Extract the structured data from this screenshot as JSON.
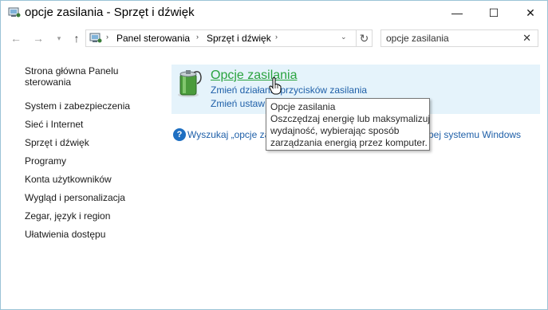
{
  "window": {
    "title": "opcje zasilania - Sprzęt i dźwięk",
    "controls": {
      "minimize": "—",
      "maximize": "☐",
      "close": "✕"
    }
  },
  "nav": {
    "back": "←",
    "forward": "→",
    "recent": "▾",
    "up": "↑",
    "breadcrumbs": [
      "Panel sterowania",
      "Sprzęt i dźwięk"
    ],
    "separator": "›",
    "dropdown": "⌄",
    "refresh": "↻"
  },
  "search": {
    "value": "opcje zasilania",
    "clear": "✕"
  },
  "sidebar": {
    "items": [
      {
        "label": "Strona główna Panelu"
      },
      {
        "label": "sterowania"
      },
      {
        "label": "System i zabezpieczenia"
      },
      {
        "label": "Sieć i Internet"
      },
      {
        "label": "Sprzęt i dźwięk"
      },
      {
        "label": "Programy"
      },
      {
        "label": "Konta użytkowników"
      },
      {
        "label": "Wygląd i personalizacja"
      },
      {
        "label": "Zegar, język i region"
      },
      {
        "label": "Ułatwienia dostępu"
      }
    ]
  },
  "result": {
    "title": "Opcje zasilania",
    "link1": "Zmień działanie przycisków zasilania",
    "link2": "Zmień ustaw"
  },
  "help": {
    "text": "Wyszukaj „opcje zasi",
    "text_tail": "pej systemu Windows",
    "icon": "?"
  },
  "tooltip": {
    "lines": [
      "Opcje zasilania",
      "Oszczędzaj energię lub maksymalizuj",
      "wydajność, wybierając sposób",
      "zarządzania energią przez komputer."
    ]
  },
  "colors": {
    "accent_link": "#1e5fa8",
    "result_title": "#2aa33f",
    "result_bg": "#e5f3fb"
  }
}
